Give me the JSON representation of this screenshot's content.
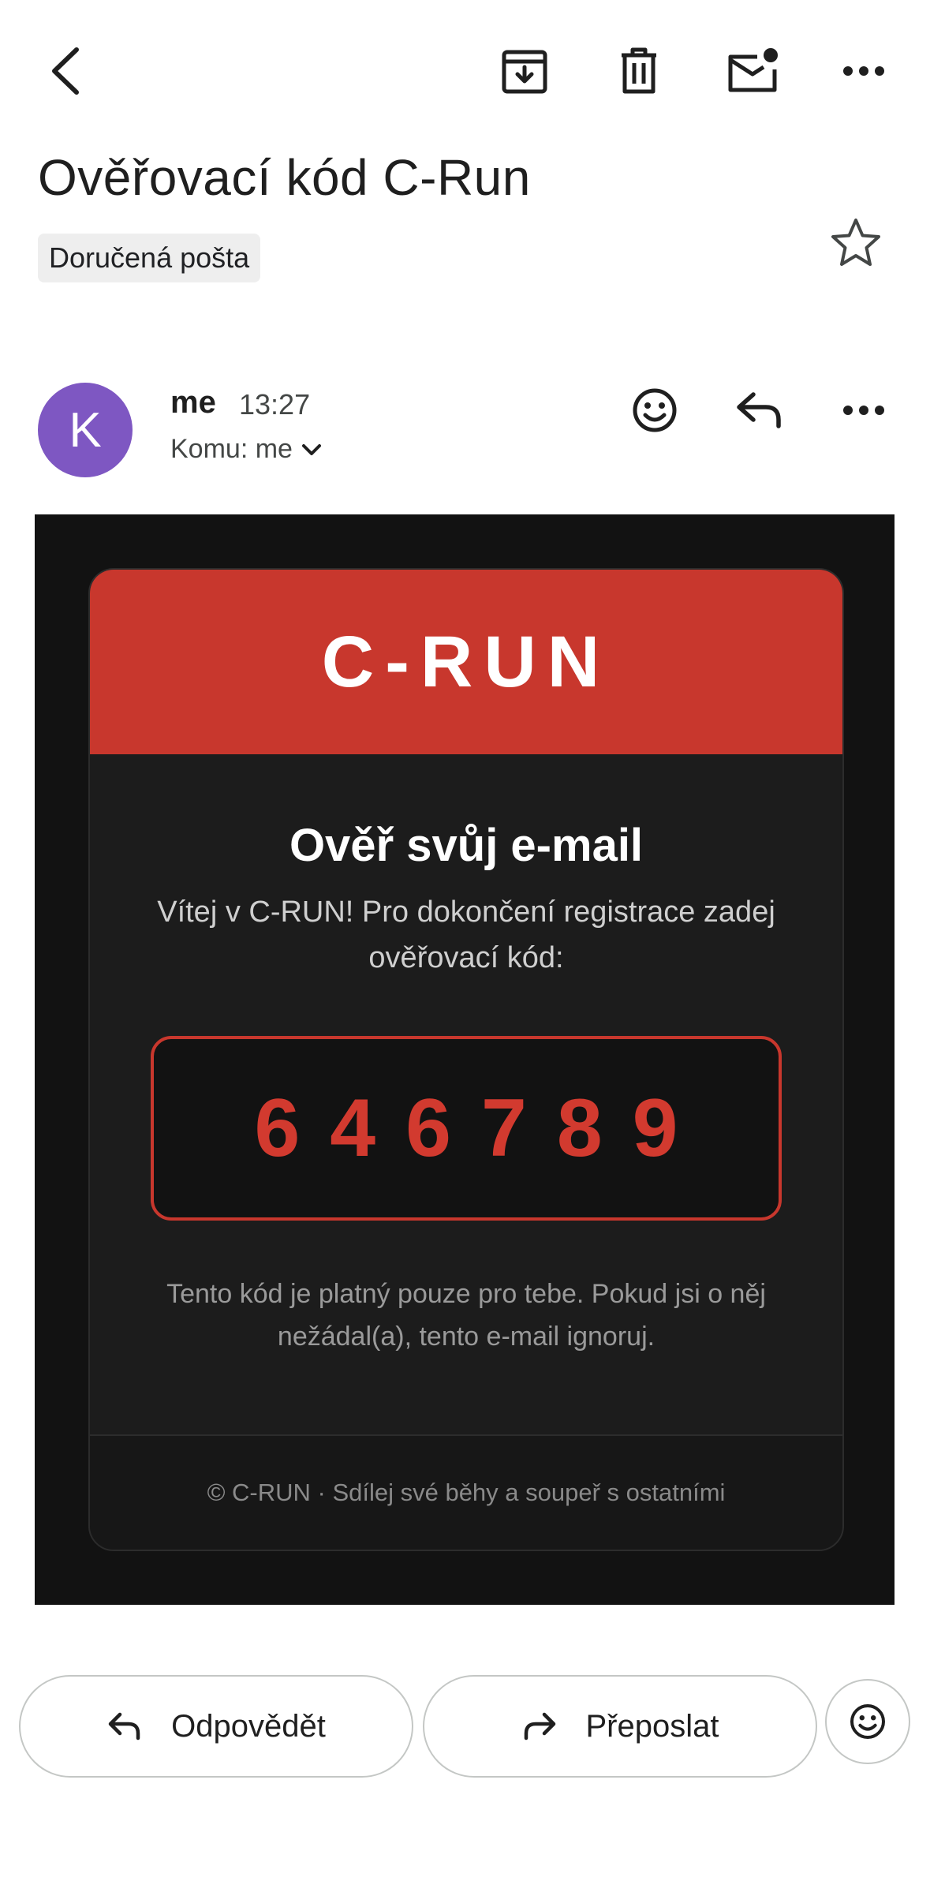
{
  "subject": "Ověřovací kód C-Run",
  "label_chip": "Doručená pošta",
  "sender": {
    "avatar_letter": "K",
    "name": "me",
    "time": "13:27",
    "recipient": "Komu: me"
  },
  "email": {
    "brand": "C-RUN",
    "title": "Ověř svůj e-mail",
    "intro": "Vítej v C-RUN! Pro dokončení registrace zadej ověřovací kód:",
    "code": "646789",
    "note": "Tento kód je platný pouze pro tebe. Pokud jsi o něj nežádal(a), tento e-mail ignoruj.",
    "footer": "© C-RUN · Sdílej své běhy a soupeř s ostatními"
  },
  "actions": {
    "reply": "Odpovědět",
    "forward": "Přeposlat"
  },
  "icons": {
    "top": [
      "back-arrow-icon",
      "archive-icon",
      "trash-icon",
      "mark-unread-icon",
      "more-options-icon"
    ],
    "star": "star-outline-icon",
    "header": [
      "emoji-reaction-icon",
      "reply-icon",
      "more-options-icon"
    ]
  },
  "colors": {
    "brand_red": "#c8372d",
    "avatar": "#7e57c2",
    "email_bg": "#121212"
  }
}
